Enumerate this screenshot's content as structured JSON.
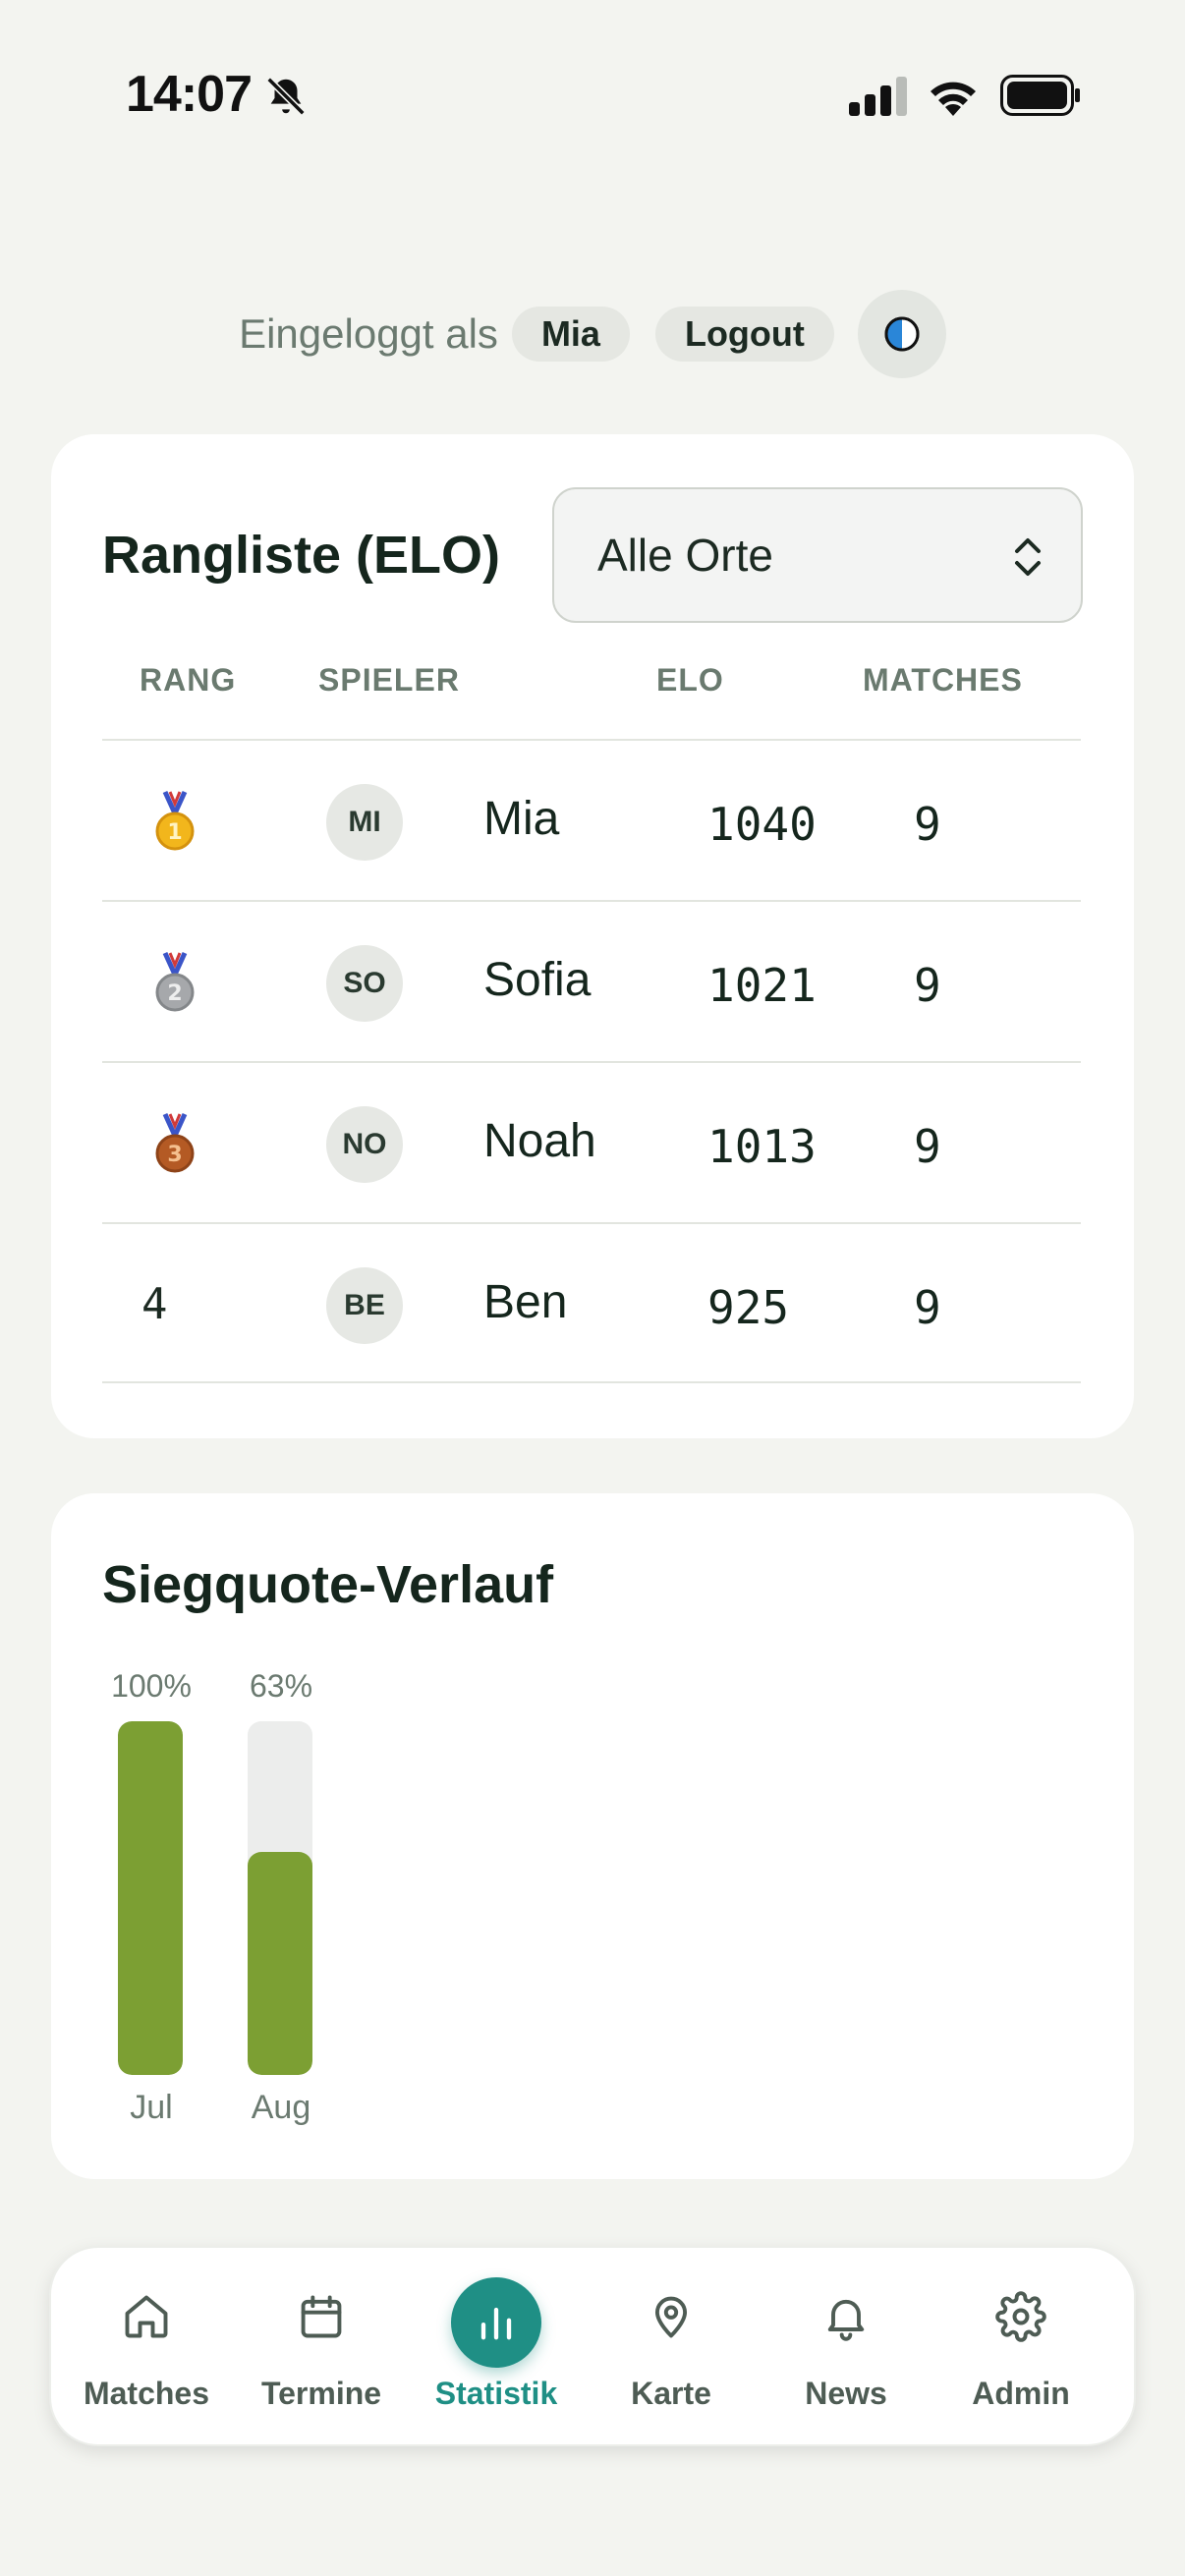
{
  "status_bar": {
    "time": "14:07"
  },
  "session": {
    "login_label": "Eingeloggt als",
    "user": "Mia",
    "logout_label": "Logout"
  },
  "ranking": {
    "title": "Rangliste (ELO)",
    "location_filter": "Alle Orte",
    "columns": [
      "RANG",
      "SPIELER",
      "ELO",
      "MATCHES"
    ],
    "rows": [
      {
        "rank": "1",
        "medal": "gold",
        "initials": "MI",
        "name": "Mia",
        "elo": "1040",
        "matches": "9"
      },
      {
        "rank": "2",
        "medal": "silver",
        "initials": "SO",
        "name": "Sofia",
        "elo": "1021",
        "matches": "9"
      },
      {
        "rank": "3",
        "medal": "bronze",
        "initials": "NO",
        "name": "Noah",
        "elo": "1013",
        "matches": "9"
      },
      {
        "rank": "4",
        "medal": "",
        "initials": "BE",
        "name": "Ben",
        "elo": "925",
        "matches": "9"
      }
    ]
  },
  "chart_data": {
    "type": "bar",
    "title": "Siegquote-Verlauf",
    "categories": [
      "Jul",
      "Aug"
    ],
    "values": [
      100,
      63
    ],
    "value_labels": [
      "100%",
      "63%"
    ],
    "ylim": [
      0,
      100
    ],
    "grid": false,
    "color": "#7c9f33"
  },
  "nav": {
    "items": [
      {
        "label": "Matches",
        "icon": "home-icon",
        "active": false
      },
      {
        "label": "Termine",
        "icon": "calendar-icon",
        "active": false
      },
      {
        "label": "Statistik",
        "icon": "bar-chart-icon",
        "active": true
      },
      {
        "label": "Karte",
        "icon": "map-pin-icon",
        "active": false
      },
      {
        "label": "News",
        "icon": "bell-icon",
        "active": false
      },
      {
        "label": "Admin",
        "icon": "gear-icon",
        "active": false
      }
    ]
  },
  "colors": {
    "accent": "#1f8f85",
    "bar": "#7c9f33",
    "background": "#f3f4f0"
  }
}
